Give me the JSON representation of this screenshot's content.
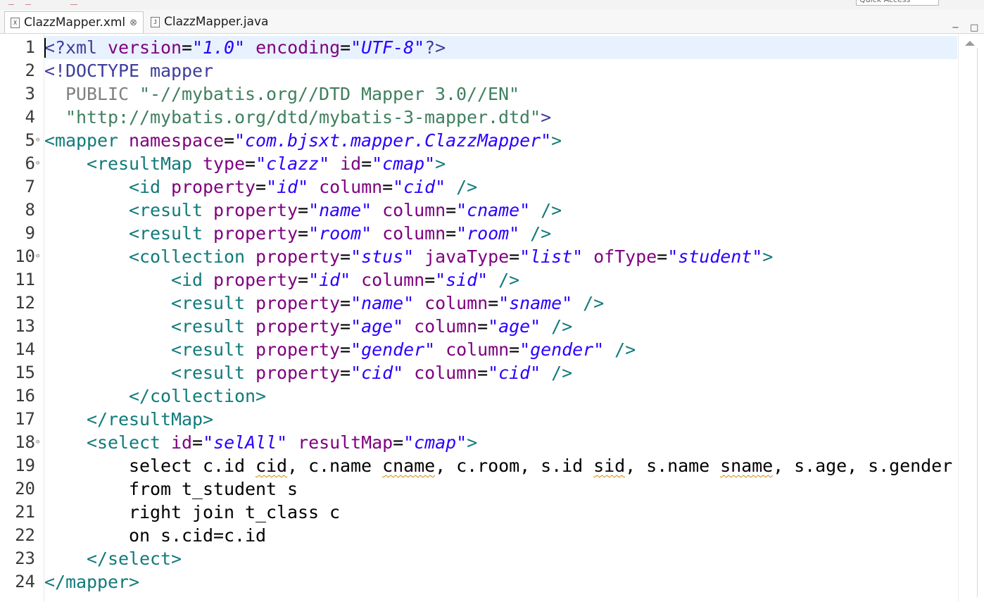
{
  "tabs": [
    {
      "label": "ClazzMapper.xml",
      "icon": "X",
      "close": "⊗",
      "active": true
    },
    {
      "label": "ClazzMapper.java",
      "icon": "J",
      "active": false
    }
  ],
  "quick_access": "Quick Access",
  "window_controls": {
    "minimize": "−",
    "maximize": "□"
  },
  "lines": [
    {
      "n": "1",
      "fold": "",
      "t": [
        [
          "kw",
          "<?xml "
        ],
        [
          "at",
          "version"
        ],
        [
          "tx",
          "="
        ],
        [
          "sv",
          "\"1.0\""
        ],
        [
          "tx",
          " "
        ],
        [
          "at",
          "encoding"
        ],
        [
          "tx",
          "="
        ],
        [
          "sv",
          "\"UTF-8\""
        ],
        [
          "kw",
          "?>"
        ]
      ]
    },
    {
      "n": "2",
      "fold": "",
      "t": [
        [
          "kw",
          "<!DOCTYPE "
        ],
        [
          "kw",
          "mapper"
        ]
      ]
    },
    {
      "n": "3",
      "fold": "",
      "t": [
        [
          "dt",
          "  PUBLIC "
        ],
        [
          "ds",
          "\"-//mybatis.org//DTD Mapper 3.0//EN\""
        ]
      ]
    },
    {
      "n": "4",
      "fold": "",
      "t": [
        [
          "ds",
          "  \"http://mybatis.org/dtd/mybatis-3-mapper.dtd\""
        ],
        [
          "kw",
          ">"
        ]
      ]
    },
    {
      "n": "5",
      "fold": "⊖",
      "t": [
        [
          "tg",
          "<mapper "
        ],
        [
          "at",
          "namespace"
        ],
        [
          "tx",
          "="
        ],
        [
          "sv",
          "\"com.bjsxt.mapper.ClazzMapper\""
        ],
        [
          "tg",
          ">"
        ]
      ]
    },
    {
      "n": "6",
      "fold": "⊖",
      "t": [
        [
          "tx",
          "    "
        ],
        [
          "tg",
          "<resultMap "
        ],
        [
          "at",
          "type"
        ],
        [
          "tx",
          "="
        ],
        [
          "sv",
          "\"clazz\""
        ],
        [
          "tx",
          " "
        ],
        [
          "at",
          "id"
        ],
        [
          "tx",
          "="
        ],
        [
          "sv",
          "\"cmap\""
        ],
        [
          "tg",
          ">"
        ]
      ]
    },
    {
      "n": "7",
      "fold": "",
      "t": [
        [
          "tx",
          "        "
        ],
        [
          "tg",
          "<id "
        ],
        [
          "at",
          "property"
        ],
        [
          "tx",
          "="
        ],
        [
          "sv",
          "\"id\""
        ],
        [
          "tx",
          " "
        ],
        [
          "at",
          "column"
        ],
        [
          "tx",
          "="
        ],
        [
          "sv",
          "\"cid\""
        ],
        [
          "tx",
          " "
        ],
        [
          "tg",
          "/>"
        ]
      ]
    },
    {
      "n": "8",
      "fold": "",
      "t": [
        [
          "tx",
          "        "
        ],
        [
          "tg",
          "<result "
        ],
        [
          "at",
          "property"
        ],
        [
          "tx",
          "="
        ],
        [
          "sv",
          "\"name\""
        ],
        [
          "tx",
          " "
        ],
        [
          "at",
          "column"
        ],
        [
          "tx",
          "="
        ],
        [
          "sv",
          "\"cname\""
        ],
        [
          "tx",
          " "
        ],
        [
          "tg",
          "/>"
        ]
      ]
    },
    {
      "n": "9",
      "fold": "",
      "t": [
        [
          "tx",
          "        "
        ],
        [
          "tg",
          "<result "
        ],
        [
          "at",
          "property"
        ],
        [
          "tx",
          "="
        ],
        [
          "sv",
          "\"room\""
        ],
        [
          "tx",
          " "
        ],
        [
          "at",
          "column"
        ],
        [
          "tx",
          "="
        ],
        [
          "sv",
          "\"room\""
        ],
        [
          "tx",
          " "
        ],
        [
          "tg",
          "/>"
        ]
      ]
    },
    {
      "n": "10",
      "fold": "⊖",
      "t": [
        [
          "tx",
          "        "
        ],
        [
          "tg",
          "<collection "
        ],
        [
          "at",
          "property"
        ],
        [
          "tx",
          "="
        ],
        [
          "sv",
          "\"stus\""
        ],
        [
          "tx",
          " "
        ],
        [
          "at",
          "javaType"
        ],
        [
          "tx",
          "="
        ],
        [
          "sv",
          "\"list\""
        ],
        [
          "tx",
          " "
        ],
        [
          "at",
          "ofType"
        ],
        [
          "tx",
          "="
        ],
        [
          "sv",
          "\"student\""
        ],
        [
          "tg",
          ">"
        ]
      ]
    },
    {
      "n": "11",
      "fold": "",
      "t": [
        [
          "tx",
          "            "
        ],
        [
          "tg",
          "<id "
        ],
        [
          "at",
          "property"
        ],
        [
          "tx",
          "="
        ],
        [
          "sv",
          "\"id\""
        ],
        [
          "tx",
          " "
        ],
        [
          "at",
          "column"
        ],
        [
          "tx",
          "="
        ],
        [
          "sv",
          "\"sid\""
        ],
        [
          "tx",
          " "
        ],
        [
          "tg",
          "/>"
        ]
      ]
    },
    {
      "n": "12",
      "fold": "",
      "t": [
        [
          "tx",
          "            "
        ],
        [
          "tg",
          "<result "
        ],
        [
          "at",
          "property"
        ],
        [
          "tx",
          "="
        ],
        [
          "sv",
          "\"name\""
        ],
        [
          "tx",
          " "
        ],
        [
          "at",
          "column"
        ],
        [
          "tx",
          "="
        ],
        [
          "sv",
          "\"sname\""
        ],
        [
          "tx",
          " "
        ],
        [
          "tg",
          "/>"
        ]
      ]
    },
    {
      "n": "13",
      "fold": "",
      "t": [
        [
          "tx",
          "            "
        ],
        [
          "tg",
          "<result "
        ],
        [
          "at",
          "property"
        ],
        [
          "tx",
          "="
        ],
        [
          "sv",
          "\"age\""
        ],
        [
          "tx",
          " "
        ],
        [
          "at",
          "column"
        ],
        [
          "tx",
          "="
        ],
        [
          "sv",
          "\"age\""
        ],
        [
          "tx",
          " "
        ],
        [
          "tg",
          "/>"
        ]
      ]
    },
    {
      "n": "14",
      "fold": "",
      "t": [
        [
          "tx",
          "            "
        ],
        [
          "tg",
          "<result "
        ],
        [
          "at",
          "property"
        ],
        [
          "tx",
          "="
        ],
        [
          "sv",
          "\"gender\""
        ],
        [
          "tx",
          " "
        ],
        [
          "at",
          "column"
        ],
        [
          "tx",
          "="
        ],
        [
          "sv",
          "\"gender\""
        ],
        [
          "tx",
          " "
        ],
        [
          "tg",
          "/>"
        ]
      ]
    },
    {
      "n": "15",
      "fold": "",
      "t": [
        [
          "tx",
          "            "
        ],
        [
          "tg",
          "<result "
        ],
        [
          "at",
          "property"
        ],
        [
          "tx",
          "="
        ],
        [
          "sv",
          "\"cid\""
        ],
        [
          "tx",
          " "
        ],
        [
          "at",
          "column"
        ],
        [
          "tx",
          "="
        ],
        [
          "sv",
          "\"cid\""
        ],
        [
          "tx",
          " "
        ],
        [
          "tg",
          "/>"
        ]
      ]
    },
    {
      "n": "16",
      "fold": "",
      "t": [
        [
          "tx",
          "        "
        ],
        [
          "tg",
          "</collection>"
        ]
      ]
    },
    {
      "n": "17",
      "fold": "",
      "t": [
        [
          "tx",
          "    "
        ],
        [
          "tg",
          "</resultMap>"
        ]
      ]
    },
    {
      "n": "18",
      "fold": "⊖",
      "t": [
        [
          "tx",
          "    "
        ],
        [
          "tg",
          "<select "
        ],
        [
          "at",
          "id"
        ],
        [
          "tx",
          "="
        ],
        [
          "sv",
          "\"selAll\""
        ],
        [
          "tx",
          " "
        ],
        [
          "at",
          "resultMap"
        ],
        [
          "tx",
          "="
        ],
        [
          "sv",
          "\"cmap\""
        ],
        [
          "tg",
          ">"
        ]
      ]
    },
    {
      "n": "19",
      "fold": "",
      "t": [
        [
          "tx",
          "        select c.id "
        ],
        [
          "sq",
          "cid"
        ],
        [
          "tx",
          ", c.name "
        ],
        [
          "sq",
          "cname"
        ],
        [
          "tx",
          ", c.room, s.id "
        ],
        [
          "sq",
          "sid"
        ],
        [
          "tx",
          ", s.name "
        ],
        [
          "sq",
          "sname"
        ],
        [
          "tx",
          ", s.age, s.gender"
        ]
      ]
    },
    {
      "n": "20",
      "fold": "",
      "t": [
        [
          "tx",
          "        from t_student s"
        ]
      ]
    },
    {
      "n": "21",
      "fold": "",
      "t": [
        [
          "tx",
          "        right join t_class c"
        ]
      ]
    },
    {
      "n": "22",
      "fold": "",
      "t": [
        [
          "tx",
          "        on s.cid=c.id"
        ]
      ]
    },
    {
      "n": "23",
      "fold": "",
      "t": [
        [
          "tx",
          "    "
        ],
        [
          "tg",
          "</select>"
        ]
      ]
    },
    {
      "n": "24",
      "fold": "",
      "t": [
        [
          "tg",
          "</mapper>"
        ]
      ]
    }
  ]
}
